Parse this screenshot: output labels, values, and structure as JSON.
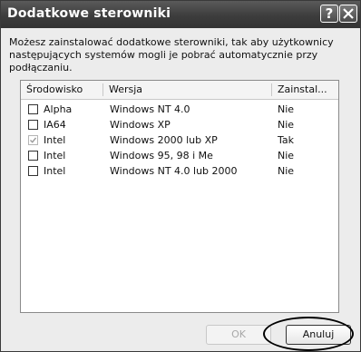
{
  "dialog": {
    "title": "Dodatkowe sterowniki",
    "help_symbol": "?",
    "description": "Możesz zainstalować dodatkowe sterowniki, tak aby użytkownicy następujących systemów mogli je pobrać automatycznie przy podłączaniu."
  },
  "table": {
    "columns": [
      "Środowisko",
      "Wersja",
      "Zainstal..."
    ],
    "rows": [
      {
        "env": "Alpha",
        "version": "Windows NT 4.0",
        "installed": "Nie",
        "checked": false
      },
      {
        "env": "IA64",
        "version": "Windows XP",
        "installed": "Nie",
        "checked": false
      },
      {
        "env": "Intel",
        "version": "Windows 2000 lub XP",
        "installed": "Tak",
        "checked": true
      },
      {
        "env": "Intel",
        "version": "Windows 95, 98 i Me",
        "installed": "Nie",
        "checked": false
      },
      {
        "env": "Intel",
        "version": "Windows NT 4.0 lub 2000",
        "installed": "Nie",
        "checked": false
      }
    ]
  },
  "buttons": {
    "ok_label": "OK",
    "cancel_label": "Anuluj"
  }
}
